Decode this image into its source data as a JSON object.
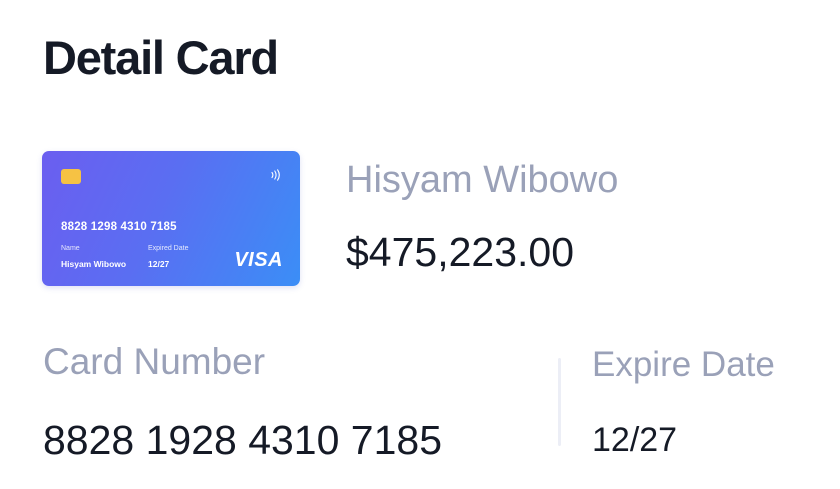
{
  "page": {
    "title": "Detail Card"
  },
  "card": {
    "number": "8828 1298 4310 7185",
    "name_label": "Name",
    "name_value": "Hisyam Wibowo",
    "expiry_label": "Expired Date",
    "expiry_value": "12/27",
    "brand": "VISA",
    "chip_icon": "chip-icon",
    "contactless_icon": "contactless-icon",
    "colors": {
      "gradient_start": "#6b5ef0",
      "gradient_end": "#3b8ef6",
      "chip": "#f6c244"
    }
  },
  "summary": {
    "holder_name": "Hisyam Wibowo",
    "balance": "$475,223.00"
  },
  "details": {
    "card_number_label": "Card Number",
    "card_number_value": "8828 1928 4310 7185",
    "expire_date_label": "Expire Date",
    "expire_date_value": "12/27"
  }
}
